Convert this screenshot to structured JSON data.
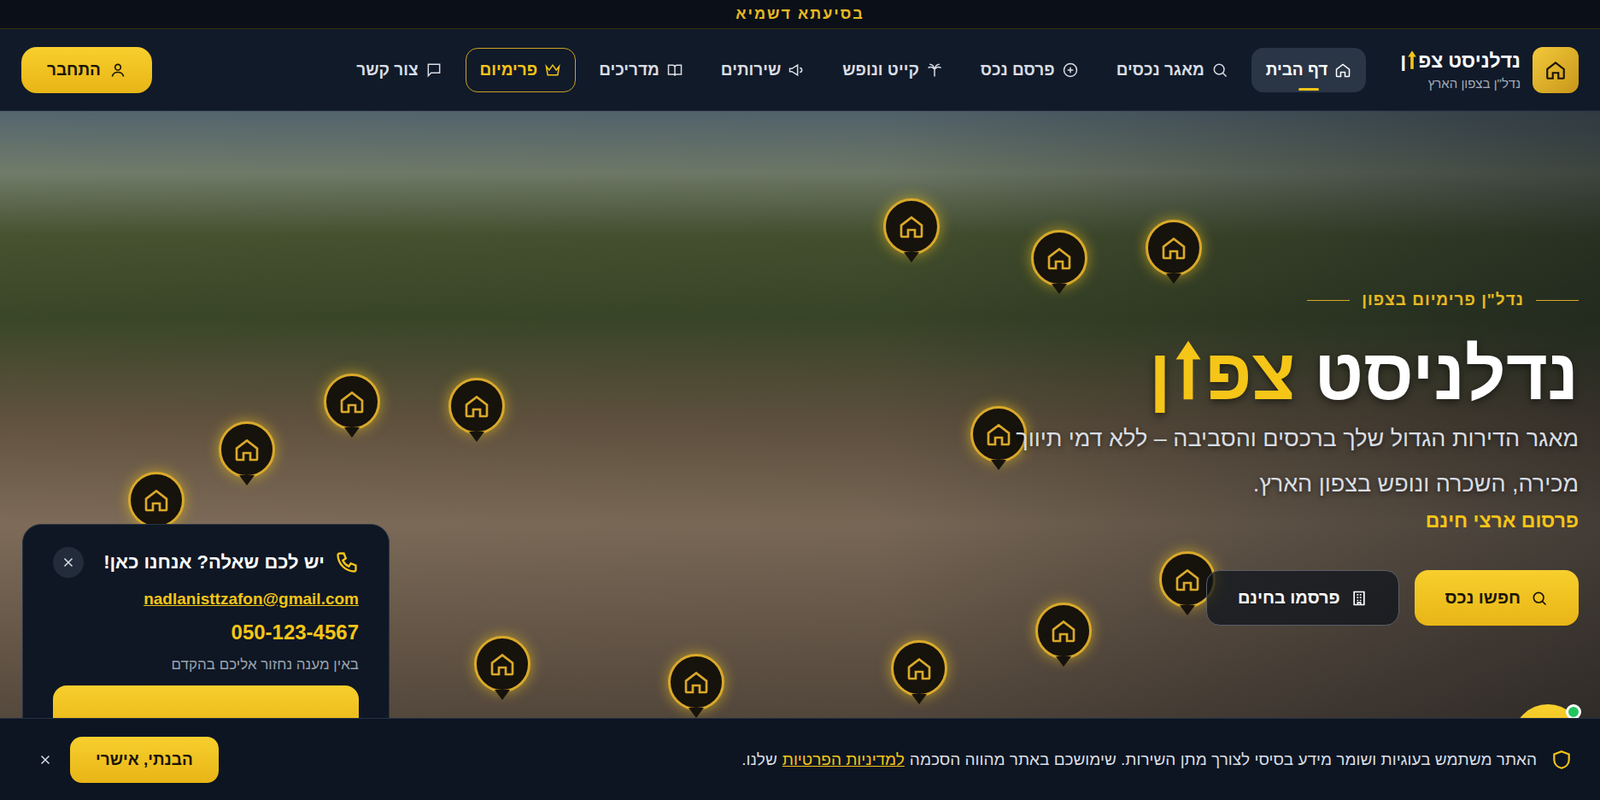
{
  "top_bar": {
    "text": "בסיעתא דשמיא"
  },
  "logo": {
    "title_main": "נדלניסט",
    "title_accent_start": "צפ",
    "title_accent_end": "ן",
    "subtitle": "נדל\"ן בצפון הארץ"
  },
  "nav": {
    "items": [
      {
        "label": "דף הבית",
        "selected": true,
        "kind": "link"
      },
      {
        "label": "מאגר נכסים",
        "selected": false,
        "kind": "link"
      },
      {
        "label": "פרסם נכס",
        "selected": false,
        "kind": "link"
      },
      {
        "label": "קייט ונופש",
        "selected": false,
        "kind": "link"
      },
      {
        "label": "שירותים",
        "selected": false,
        "kind": "link"
      },
      {
        "label": "מדריכים",
        "selected": false,
        "kind": "link"
      },
      {
        "label": "פרימיום",
        "selected": false,
        "kind": "premium"
      },
      {
        "label": "צור קשר",
        "selected": false,
        "kind": "link"
      }
    ]
  },
  "login_button": {
    "label": "התחבר"
  },
  "hero": {
    "eyebrow": "נדל\"ן פרימיום בצפון",
    "title_main": "נדלניסט",
    "title_accent_start": "צפ",
    "title_accent_end": "ן",
    "subtitle_lines": [
      "מאגר הדירות הגדול שלך ברכסים והסביבה – ללא דמי תיווך",
      "מכירה, השכרה ונופש בצפון הארץ."
    ],
    "highlight": "פרסום ארצי חינם",
    "primary_button": "חפשו נכס",
    "secondary_button": "פרסמו בחינם"
  },
  "contact_popup": {
    "title": "יש לכם שאלה? אנחנו כאן!",
    "email": "nadlanisttzafon@gmail.com",
    "phone": "050-123-4567",
    "note": "באין מענה נחזור אליכם בהקדם"
  },
  "chat_widget": {
    "online": true
  },
  "cookie_bar": {
    "text": "האתר משתמש בעוגיות ושומר מידע בסיסי לצורך מתן השירות. שימושכם באתר מהווה הסכמה",
    "link": "למדיניות הפרטיות",
    "suffix": "שלנו.",
    "accept": "הבנתי, אישרי"
  }
}
